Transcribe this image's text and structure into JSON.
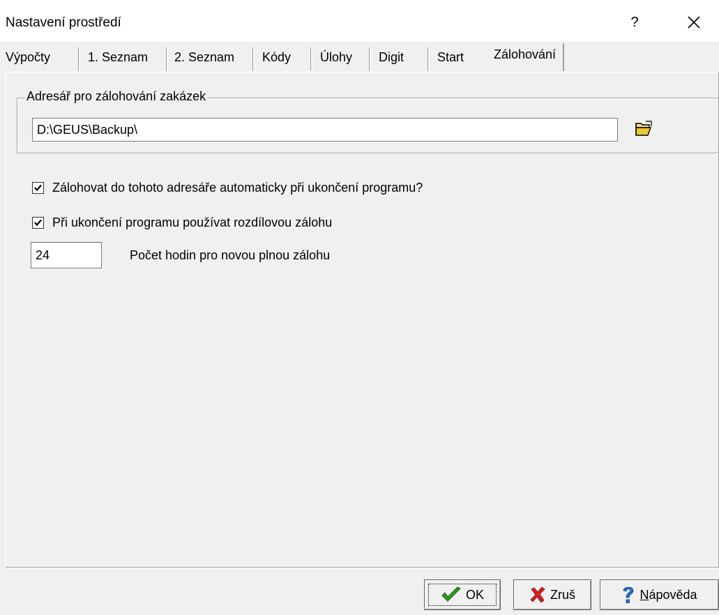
{
  "window": {
    "title": "Nastavení prostředí",
    "help_glyph": "?",
    "close_glyph": "✕"
  },
  "tabs": [
    {
      "label": "Výpočty"
    },
    {
      "label": "1. Seznam"
    },
    {
      "label": "2. Seznam"
    },
    {
      "label": "Kódy"
    },
    {
      "label": "Úlohy"
    },
    {
      "label": "Digit"
    },
    {
      "label": "Start"
    },
    {
      "label": "Zálohování",
      "active": true
    }
  ],
  "backup": {
    "group_label": "Adresář pro zálohování zakázek",
    "directory": "D:\\GEUS\\Backup\\",
    "browse_icon": "folder-open-icon",
    "auto_backup_label": "Zálohovat do tohoto adresáře automaticky při ukončení programu?",
    "auto_backup_checked": true,
    "diff_backup_label": "Při ukončení programu používat rozdílovou zálohu",
    "diff_backup_checked": true,
    "hours_value": "24",
    "hours_label": "Počet hodin pro novou plnou zálohu"
  },
  "buttons": {
    "ok_label": "OK",
    "cancel_label": "Zruš",
    "help_accel": "N",
    "help_rest": "ápověda"
  },
  "colors": {
    "ok_check": "#2e9a1e",
    "cancel_x": "#d42020",
    "help_q": "#1e6fd6"
  }
}
